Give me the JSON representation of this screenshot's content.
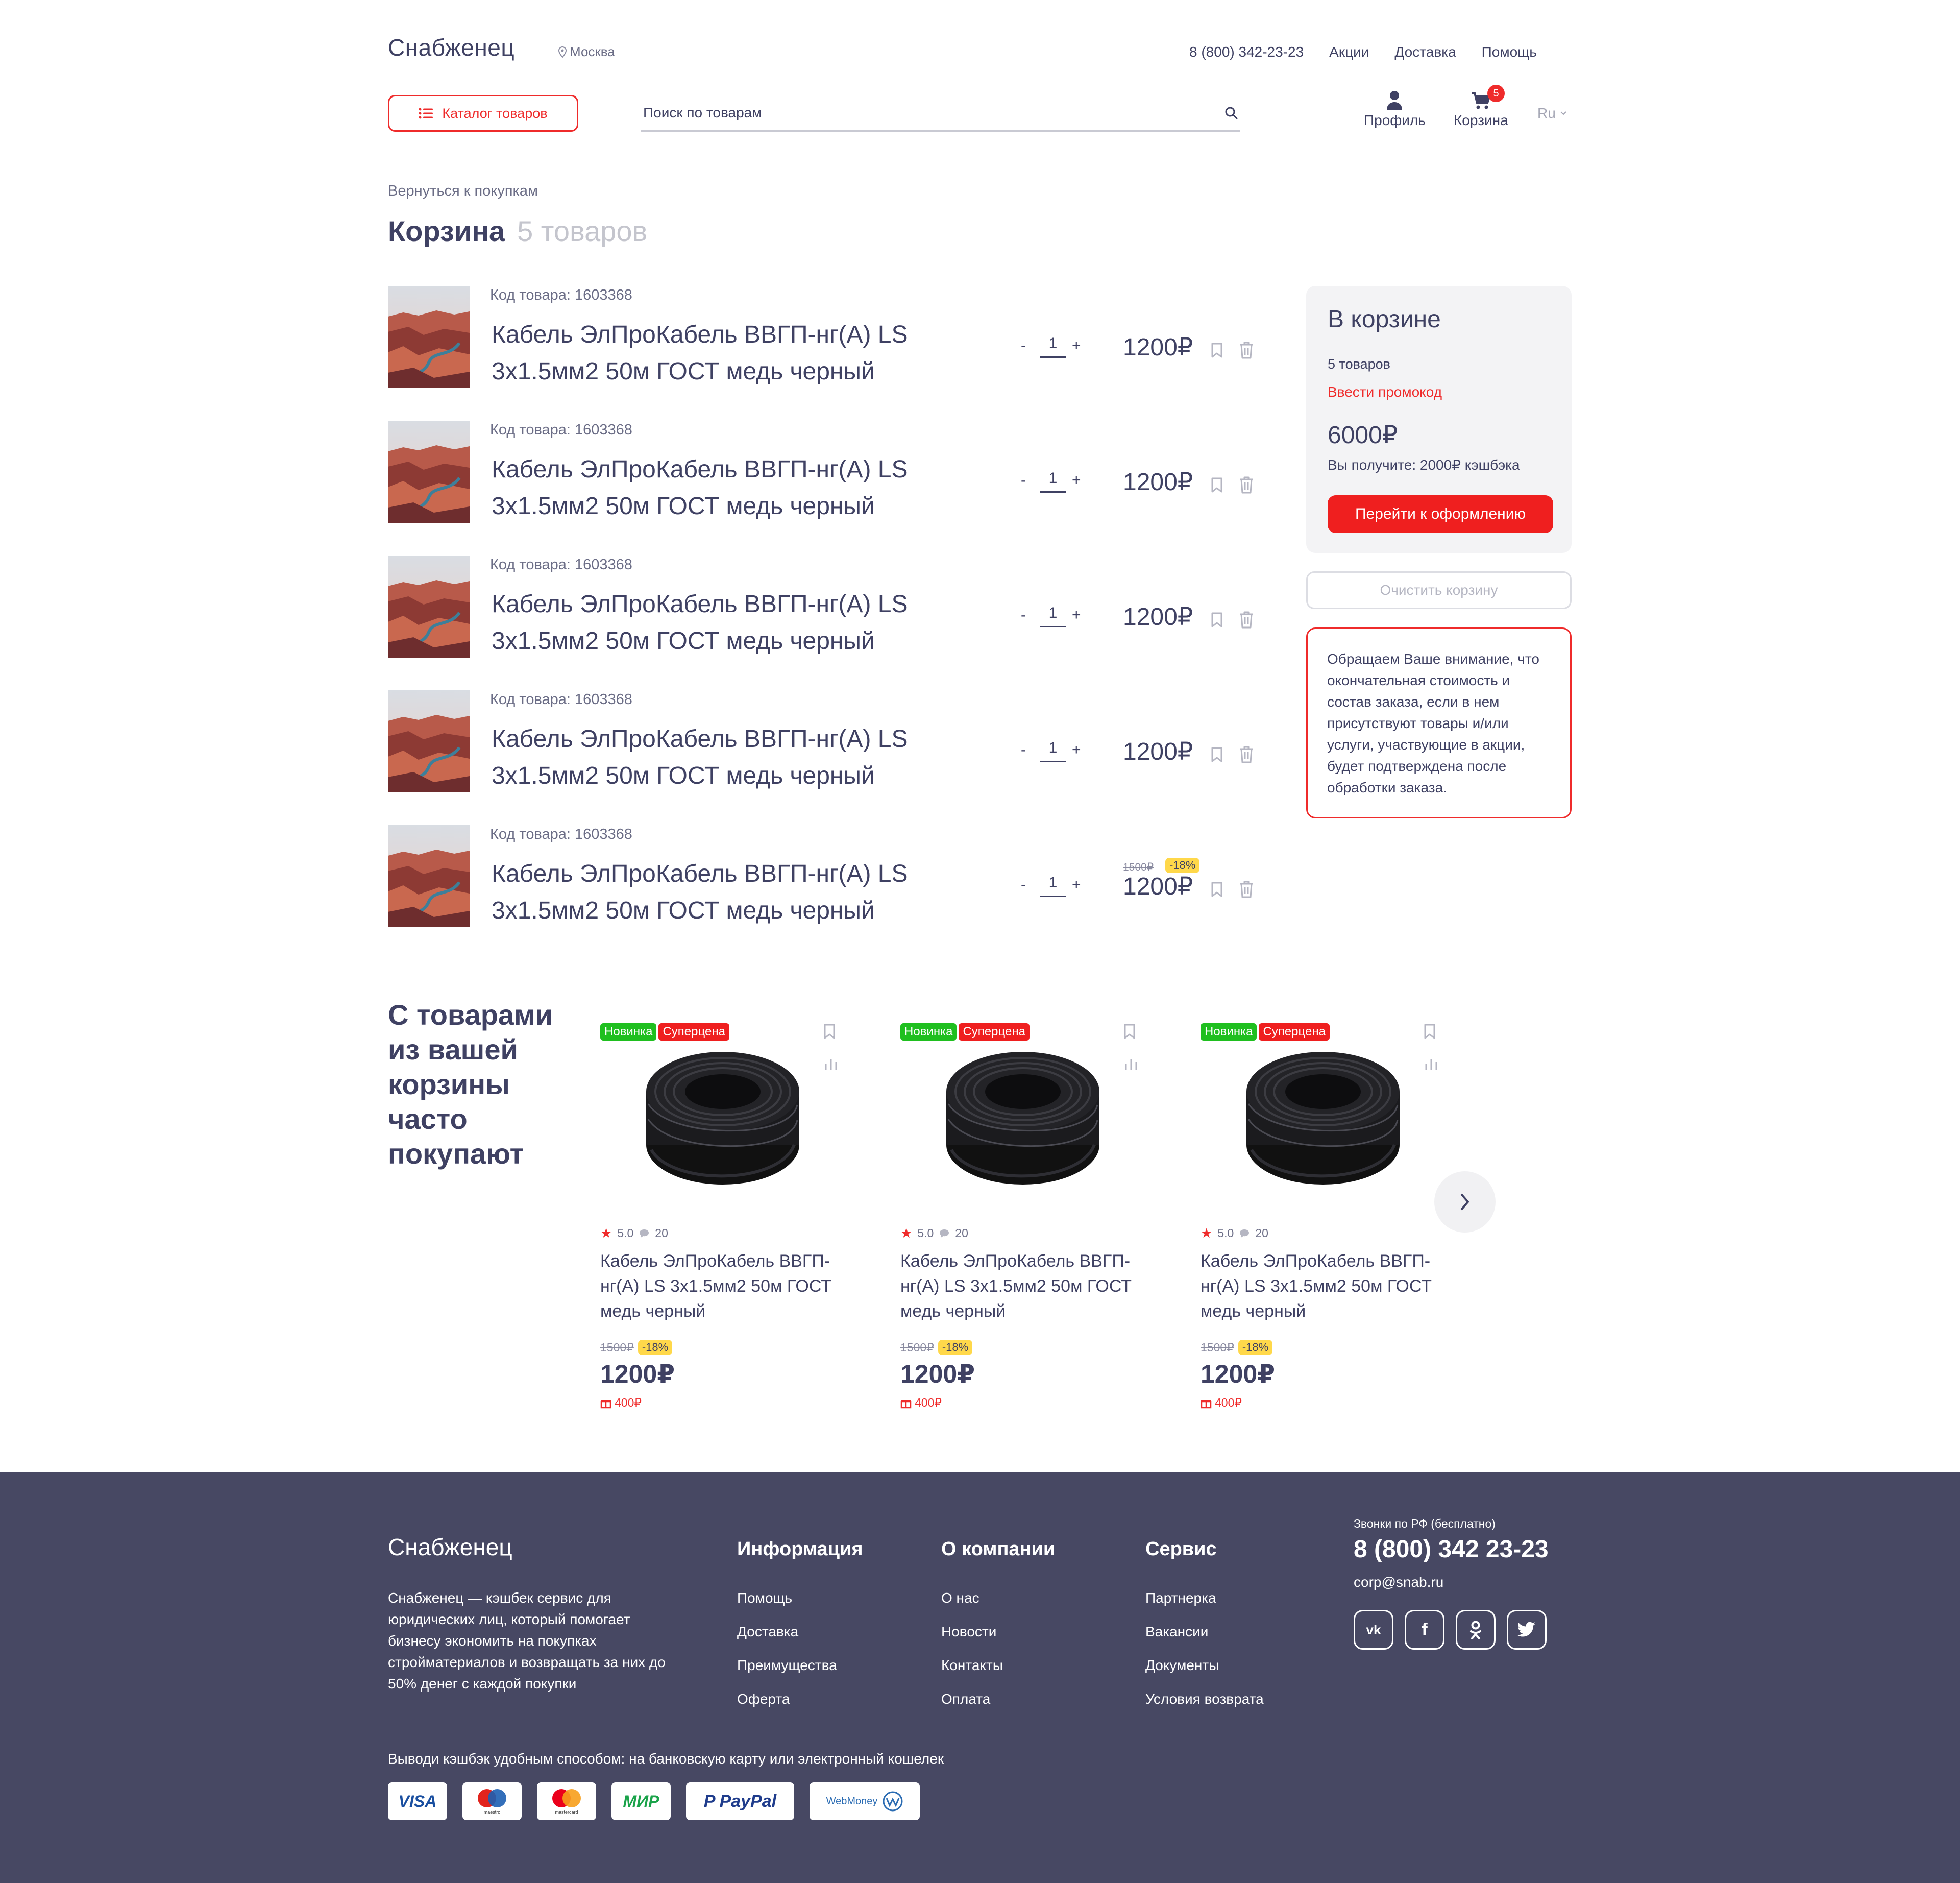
{
  "header": {
    "brand": "Снабженец",
    "city": "Москва",
    "phone": "8 (800) 342-23-23",
    "nav": [
      "Акции",
      "Доставка",
      "Помощь"
    ],
    "catalog_label": "Каталог товаров",
    "search_placeholder": "Поиск по товарам",
    "profile_label": "Профиль",
    "cart_label": "Корзина",
    "cart_badge": "5",
    "lang": "Ru"
  },
  "cart": {
    "back_link": "Вернуться к покупкам",
    "title": "Корзина",
    "count": "5 товаров",
    "items": [
      {
        "code": "Код товара: 1603368",
        "name": "Кабель ЭлПроКабель ВВГП-нг(А) LS 3х1.5мм2 50м ГОСТ медь черный",
        "qty": "1",
        "price": "1200₽"
      },
      {
        "code": "Код товара: 1603368",
        "name": "Кабель ЭлПроКабель ВВГП-нг(А) LS 3х1.5мм2 50м ГОСТ медь черный",
        "qty": "1",
        "price": "1200₽"
      },
      {
        "code": "Код товара: 1603368",
        "name": "Кабель ЭлПроКабель ВВГП-нг(А) LS 3х1.5мм2 50м ГОСТ медь черный",
        "qty": "1",
        "price": "1200₽"
      },
      {
        "code": "Код товара: 1603368",
        "name": "Кабель ЭлПроКабель ВВГП-нг(А) LS 3х1.5мм2 50м ГОСТ медь черный",
        "qty": "1",
        "price": "1200₽"
      },
      {
        "code": "Код товара: 1603368",
        "name": "Кабель ЭлПроКабель ВВГП-нг(А) LS 3х1.5мм2 50м ГОСТ медь черный",
        "qty": "1",
        "price": "1200₽",
        "old_price": "1500₽",
        "discount": "-18%"
      }
    ],
    "qty_minus": "-",
    "qty_plus": "+"
  },
  "summary": {
    "title": "В корзине",
    "count": "5 товаров",
    "promo": "Ввести промокод",
    "total": "6000₽",
    "cashback": "Вы получите: 2000₽ кэшбэка",
    "checkout": "Перейти к оформлению",
    "clear": "Очистить корзину",
    "notice": "Обращаем Ваше внимание, что окончательная стоимость и состав заказа, если в нем присутствуют товары и/или услуги, участвующие в акции, будет подтверждена после обработки заказа."
  },
  "recommendations": {
    "title": "С товарами из вашей корзины часто покупают",
    "products": [
      {
        "badge_new": "Новинка",
        "badge_super": "Суперцена",
        "rating": "5.0",
        "reviews": "20",
        "name": "Кабель ЭлПроКабель ВВГП-нг(А) LS 3х1.5мм2 50м ГОСТ медь черный",
        "old_price": "1500₽",
        "discount": "-18%",
        "price": "1200₽",
        "cashback": "400₽"
      },
      {
        "badge_new": "Новинка",
        "badge_super": "Суперцена",
        "rating": "5.0",
        "reviews": "20",
        "name": "Кабель ЭлПроКабель ВВГП-нг(А) LS 3х1.5мм2 50м ГОСТ медь черный",
        "old_price": "1500₽",
        "discount": "-18%",
        "price": "1200₽",
        "cashback": "400₽"
      },
      {
        "badge_new": "Новинка",
        "badge_super": "Суперцена",
        "rating": "5.0",
        "reviews": "20",
        "name": "Кабель ЭлПроКабель ВВГП-нг(А) LS 3х1.5мм2 50м ГОСТ медь черный",
        "old_price": "1500₽",
        "discount": "-18%",
        "price": "1200₽",
        "cashback": "400₽"
      }
    ]
  },
  "footer": {
    "brand": "Снабженец",
    "about": "Снабженец — кэшбек сервис для юридических лиц, который помогает бизнесу экономить на покупках стройматериалов и возвращать за них до 50% денег с каждой покупки",
    "columns": [
      {
        "title": "Информация",
        "links": [
          "Помощь",
          "Доставка",
          "Преимущества",
          "Оферта"
        ]
      },
      {
        "title": "О компании",
        "links": [
          "О нас",
          "Новости",
          "Контакты",
          "Оплата"
        ]
      },
      {
        "title": "Сервис",
        "links": [
          "Партнерка",
          "Вакансии",
          "Документы",
          "Условия возврата"
        ]
      }
    ],
    "phone_caption": "Звонки по РФ (бесплатно)",
    "phone": "8 (800) 342 23-23",
    "email": "corp@snab.ru",
    "socials": [
      "vk-icon",
      "facebook-icon",
      "odnoklassniki-icon",
      "twitter-icon"
    ],
    "payments_caption": "Выводи кэшбэк удобным способом: на банковскую карту или электронный кошелек",
    "payments": [
      "VISA",
      "maestro",
      "mastercard",
      "МИР",
      "PayPal",
      "WebMoney"
    ]
  },
  "colors": {
    "accent": "#ef2b2b",
    "text": "#3f4163",
    "footer_bg": "#474863",
    "discount_bg": "#ffd84a",
    "badge_new": "#1fbf1f"
  }
}
